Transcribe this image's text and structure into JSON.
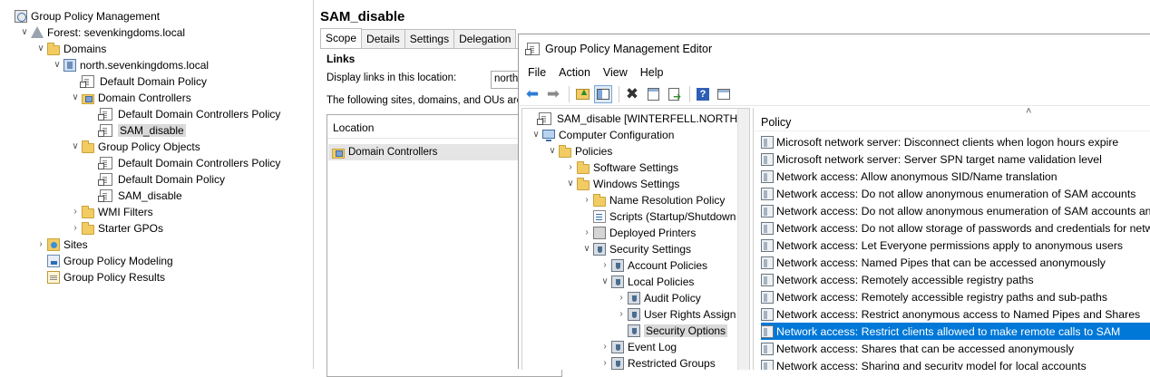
{
  "gpmc_tree": {
    "items": [
      {
        "label": "Group Policy Management",
        "icon": "gpm-icon",
        "toggle": ""
      },
      {
        "label": "Forest: sevenkingdoms.local",
        "icon": "forest-icon",
        "toggle": "v"
      },
      {
        "label": "Domains",
        "icon": "folder-icon",
        "toggle": "v"
      },
      {
        "label": "north.sevenkingdoms.local",
        "icon": "domain-icon",
        "toggle": "v"
      },
      {
        "label": "Default Domain Policy",
        "icon": "gpo-link-icon",
        "toggle": ""
      },
      {
        "label": "Domain Controllers",
        "icon": "ou-icon",
        "toggle": "v"
      },
      {
        "label": "Default Domain Controllers Policy",
        "icon": "gpo-link-icon",
        "toggle": ""
      },
      {
        "label": "SAM_disable",
        "icon": "gpo-link-icon",
        "toggle": "",
        "selected": true
      },
      {
        "label": "Group Policy Objects",
        "icon": "folder-icon",
        "toggle": "v"
      },
      {
        "label": "Default Domain Controllers Policy",
        "icon": "gpo-icon",
        "toggle": ""
      },
      {
        "label": "Default Domain Policy",
        "icon": "gpo-icon",
        "toggle": ""
      },
      {
        "label": "SAM_disable",
        "icon": "gpo-icon",
        "toggle": ""
      },
      {
        "label": "WMI Filters",
        "icon": "folder-icon",
        "toggle": ">"
      },
      {
        "label": "Starter GPOs",
        "icon": "folder-icon",
        "toggle": ">"
      },
      {
        "label": "Sites",
        "icon": "sites-icon",
        "toggle": ">"
      },
      {
        "label": "Group Policy Modeling",
        "icon": "modeling-icon",
        "toggle": ""
      },
      {
        "label": "Group Policy Results",
        "icon": "results-icon",
        "toggle": ""
      }
    ]
  },
  "middle": {
    "title": "SAM_disable",
    "tabs": [
      "Scope",
      "Details",
      "Settings",
      "Delegation"
    ],
    "links_header": "Links",
    "display_links_label": "Display links in this location:",
    "display_links_value": "north",
    "following_text": "The following sites, domains, and OUs are lin",
    "location_header": "Location",
    "location_row": "Domain Controllers"
  },
  "editor": {
    "title": "Group Policy Management Editor",
    "menu": [
      "File",
      "Action",
      "View",
      "Help"
    ],
    "toolbar": [
      "back-icon",
      "forward-icon",
      "up-icon",
      "show-hide-tree-icon",
      "delete-icon",
      "properties-icon",
      "export-icon",
      "help-icon",
      "filter-icon"
    ],
    "tree": [
      {
        "label": "SAM_disable [WINTERFELL.NORTH.SEVE",
        "icon": "gpo-icon",
        "toggle": ""
      },
      {
        "label": "Computer Configuration",
        "icon": "computer-icon",
        "toggle": "v"
      },
      {
        "label": "Policies",
        "icon": "folder-icon",
        "toggle": "v"
      },
      {
        "label": "Software Settings",
        "icon": "folder-icon",
        "toggle": ">"
      },
      {
        "label": "Windows Settings",
        "icon": "folder-icon",
        "toggle": "v"
      },
      {
        "label": "Name Resolution Policy",
        "icon": "folder-icon",
        "toggle": ">"
      },
      {
        "label": "Scripts (Startup/Shutdown",
        "icon": "script-icon",
        "toggle": ""
      },
      {
        "label": "Deployed Printers",
        "icon": "printer-icon",
        "toggle": ">"
      },
      {
        "label": "Security Settings",
        "icon": "security-icon",
        "toggle": "v"
      },
      {
        "label": "Account Policies",
        "icon": "security-icon",
        "toggle": ">"
      },
      {
        "label": "Local Policies",
        "icon": "security-icon",
        "toggle": "v"
      },
      {
        "label": "Audit Policy",
        "icon": "security-icon",
        "toggle": ">"
      },
      {
        "label": "User Rights Assign",
        "icon": "security-icon",
        "toggle": ">"
      },
      {
        "label": "Security Options",
        "icon": "security-icon",
        "toggle": "",
        "selected": true
      },
      {
        "label": "Event Log",
        "icon": "security-icon",
        "toggle": ">"
      },
      {
        "label": "Restricted Groups",
        "icon": "security-icon",
        "toggle": ">"
      }
    ],
    "policy_header": "Policy",
    "policies": [
      {
        "label": "Microsoft network server: Disconnect clients when logon hours expire"
      },
      {
        "label": "Microsoft network server: Server SPN target name validation level"
      },
      {
        "label": "Network access: Allow anonymous SID/Name translation"
      },
      {
        "label": "Network access: Do not allow anonymous enumeration of SAM accounts"
      },
      {
        "label": "Network access: Do not allow anonymous enumeration of SAM accounts and s"
      },
      {
        "label": "Network access: Do not allow storage of passwords and credentials for network"
      },
      {
        "label": "Network access: Let Everyone permissions apply to anonymous users"
      },
      {
        "label": "Network access: Named Pipes that can be accessed anonymously"
      },
      {
        "label": "Network access: Remotely accessible registry paths"
      },
      {
        "label": "Network access: Remotely accessible registry paths and sub-paths"
      },
      {
        "label": "Network access: Restrict anonymous access to Named Pipes and Shares"
      },
      {
        "label": "Network access: Restrict clients allowed to make remote calls to SAM",
        "selected": true
      },
      {
        "label": "Network access: Shares that can be accessed anonymously"
      },
      {
        "label": "Network access: Sharing and security model for local accounts"
      }
    ]
  }
}
